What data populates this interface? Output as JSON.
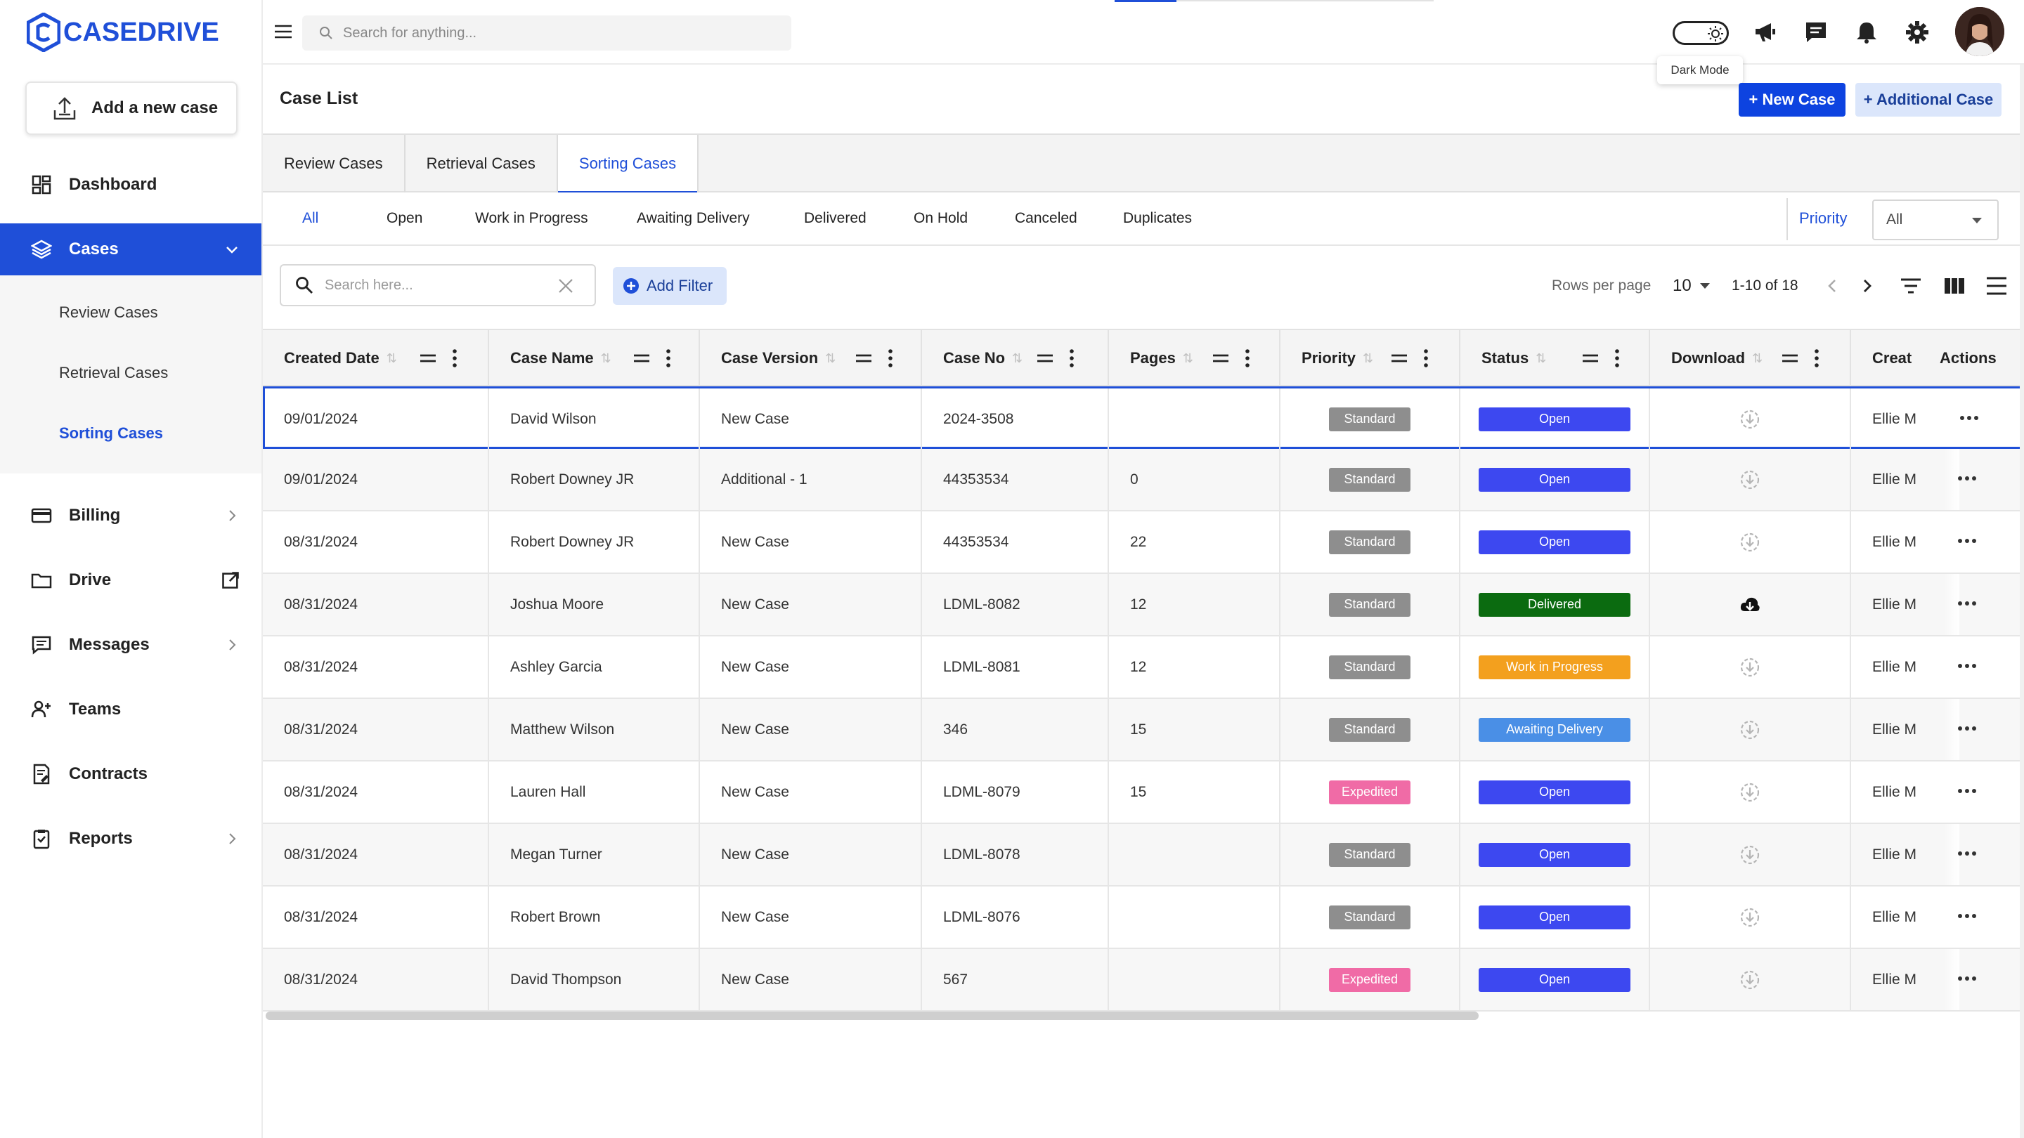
{
  "app": {
    "brand": "CASEDRIVE",
    "add_case_label": "Add a new case"
  },
  "colors": {
    "accent": "#1f4fd8",
    "open": "#3d48f0",
    "delivered": "#0b6b10",
    "wip": "#f3a01e",
    "awaiting": "#4a8fe6",
    "standard": "#8e8e8e",
    "expedited": "#f06ba6"
  },
  "sidebar": {
    "items": [
      {
        "label": "Dashboard",
        "icon": "dashboard-icon"
      },
      {
        "label": "Cases",
        "icon": "layers-icon",
        "active": true,
        "children": [
          {
            "label": "Review Cases"
          },
          {
            "label": "Retrieval Cases"
          },
          {
            "label": "Sorting Cases",
            "active": true
          }
        ]
      },
      {
        "label": "Billing",
        "icon": "card-icon"
      },
      {
        "label": "Drive",
        "icon": "folder-icon"
      },
      {
        "label": "Messages",
        "icon": "message-icon"
      },
      {
        "label": "Teams",
        "icon": "team-icon"
      },
      {
        "label": "Contracts",
        "icon": "contract-icon"
      },
      {
        "label": "Reports",
        "icon": "report-icon"
      }
    ]
  },
  "topbar": {
    "search_placeholder": "Search for anything...",
    "tooltip": "Dark Mode"
  },
  "page": {
    "title": "Case List",
    "new_case": "+ New Case",
    "additional_case": "+ Additional Case"
  },
  "main_tabs": [
    {
      "label": "Review Cases"
    },
    {
      "label": "Retrieval Cases"
    },
    {
      "label": "Sorting Cases",
      "active": true
    }
  ],
  "status_tabs": [
    {
      "label": "All",
      "active": true
    },
    {
      "label": "Open"
    },
    {
      "label": "Work in Progress"
    },
    {
      "label": "Awaiting Delivery"
    },
    {
      "label": "Delivered"
    },
    {
      "label": "On Hold"
    },
    {
      "label": "Canceled"
    },
    {
      "label": "Duplicates"
    }
  ],
  "priority_filter": {
    "label": "Priority",
    "value": "All"
  },
  "toolbar": {
    "search_placeholder": "Search here...",
    "add_filter": "Add Filter",
    "rows_per_page_label": "Rows per page",
    "rows_per_page": "10",
    "range": "1-10 of 18"
  },
  "table": {
    "columns": [
      "Created Date",
      "Case Name",
      "Case Version",
      "Case No",
      "Pages",
      "Priority",
      "Status",
      "Download",
      "Creat",
      "Actions"
    ],
    "rows": [
      {
        "date": "09/01/2024",
        "name": "David Wilson",
        "version": "New Case",
        "no": "2024-3508",
        "pages": "",
        "priority": "Standard",
        "status": "Open",
        "download": "pending",
        "creator": "Ellie M"
      },
      {
        "date": "09/01/2024",
        "name": "Robert Downey JR",
        "version": "Additional - 1",
        "no": "44353534",
        "pages": "0",
        "priority": "Standard",
        "status": "Open",
        "download": "pending",
        "creator": "Ellie M"
      },
      {
        "date": "08/31/2024",
        "name": "Robert Downey JR",
        "version": "New Case",
        "no": "44353534",
        "pages": "22",
        "priority": "Standard",
        "status": "Open",
        "download": "pending",
        "creator": "Ellie M"
      },
      {
        "date": "08/31/2024",
        "name": "Joshua Moore",
        "version": "New Case",
        "no": "LDML-8082",
        "pages": "12",
        "priority": "Standard",
        "status": "Delivered",
        "download": "ready",
        "creator": "Ellie M"
      },
      {
        "date": "08/31/2024",
        "name": "Ashley Garcia",
        "version": "New Case",
        "no": "LDML-8081",
        "pages": "12",
        "priority": "Standard",
        "status": "Work in Progress",
        "download": "pending",
        "creator": "Ellie M"
      },
      {
        "date": "08/31/2024",
        "name": "Matthew Wilson",
        "version": "New Case",
        "no": "346",
        "pages": "15",
        "priority": "Standard",
        "status": "Awaiting Delivery",
        "download": "pending",
        "creator": "Ellie M"
      },
      {
        "date": "08/31/2024",
        "name": "Lauren Hall",
        "version": "New Case",
        "no": "LDML-8079",
        "pages": "15",
        "priority": "Expedited",
        "status": "Open",
        "download": "pending",
        "creator": "Ellie M"
      },
      {
        "date": "08/31/2024",
        "name": "Megan Turner",
        "version": "New Case",
        "no": "LDML-8078",
        "pages": "",
        "priority": "Standard",
        "status": "Open",
        "download": "pending",
        "creator": "Ellie M"
      },
      {
        "date": "08/31/2024",
        "name": "Robert Brown",
        "version": "New Case",
        "no": "LDML-8076",
        "pages": "",
        "priority": "Standard",
        "status": "Open",
        "download": "pending",
        "creator": "Ellie M"
      },
      {
        "date": "08/31/2024",
        "name": "David Thompson",
        "version": "New Case",
        "no": "567",
        "pages": "",
        "priority": "Expedited",
        "status": "Open",
        "download": "pending",
        "creator": "Ellie M"
      }
    ]
  }
}
